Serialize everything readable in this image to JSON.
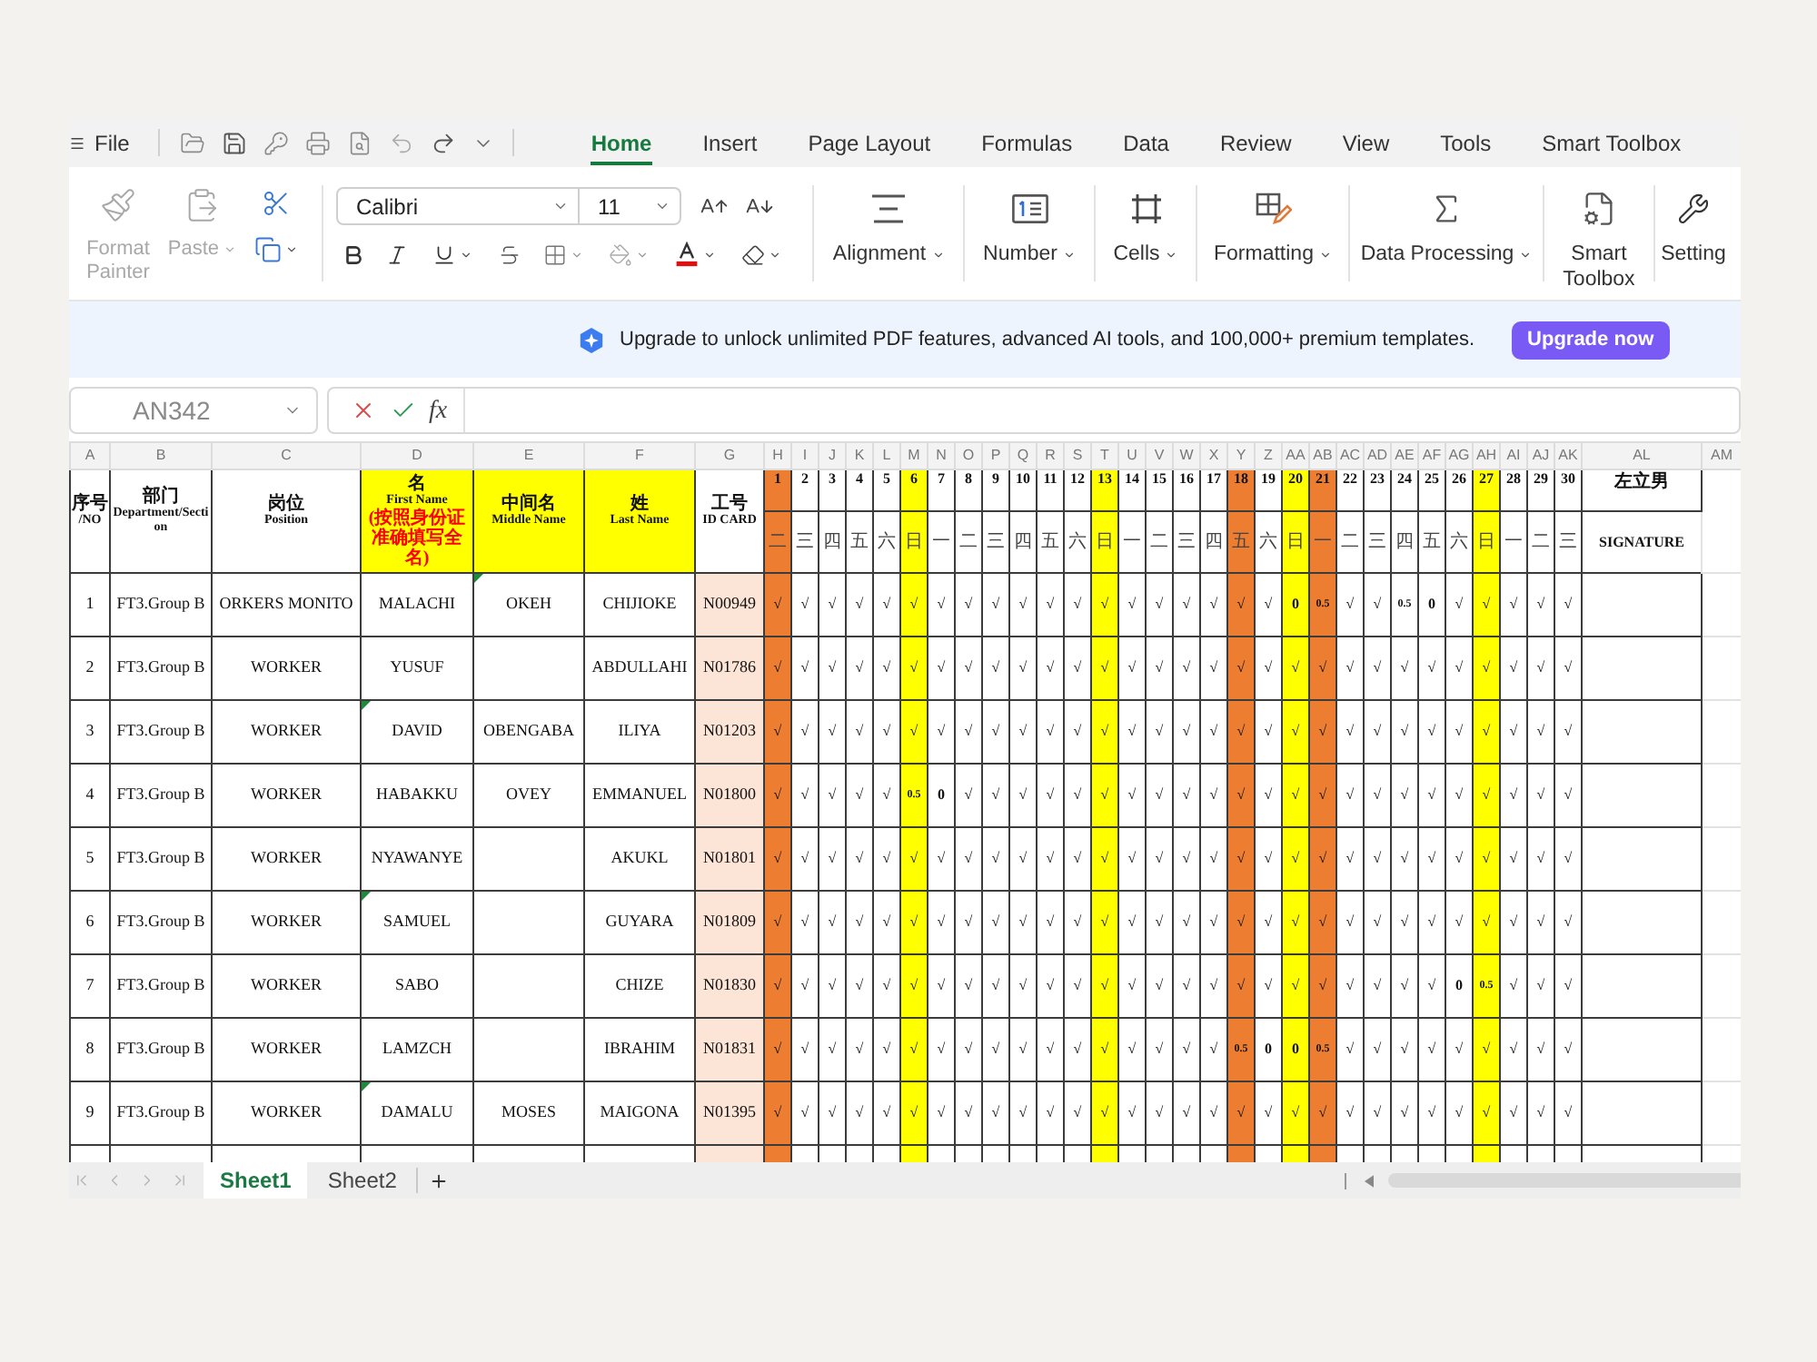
{
  "menu_bar": {
    "file": "File",
    "tabs": [
      {
        "label": "Home",
        "selected": true
      },
      {
        "label": "Insert",
        "selected": false
      },
      {
        "label": "Page Layout",
        "selected": false
      },
      {
        "label": "Formulas",
        "selected": false
      },
      {
        "label": "Data",
        "selected": false
      },
      {
        "label": "Review",
        "selected": false
      },
      {
        "label": "View",
        "selected": false
      },
      {
        "label": "Tools",
        "selected": false
      },
      {
        "label": "Smart Toolbox",
        "selected": false
      }
    ]
  },
  "ribbon": {
    "clipboard": [
      {
        "kind": "format_painter",
        "label": "Format Painter",
        "disabled": true
      },
      {
        "kind": "paste",
        "label": "Paste",
        "disabled": true
      }
    ],
    "font": {
      "family": "Calibri",
      "size": "11"
    },
    "groups": [
      {
        "kind": "alignment",
        "label": "Alignment",
        "dropdown": true
      },
      {
        "kind": "number",
        "label": "Number",
        "dropdown": true
      },
      {
        "kind": "cells",
        "label": "Cells",
        "dropdown": true
      },
      {
        "kind": "formatting",
        "label": "Formatting",
        "dropdown": true
      },
      {
        "kind": "data_processing",
        "label": "Data Processing",
        "dropdown": true
      },
      {
        "kind": "smart_toolbox",
        "label": "Smart Toolbox",
        "dropdown": false
      },
      {
        "kind": "setting",
        "label": "Setting",
        "dropdown": false
      }
    ]
  },
  "banner": {
    "message": "Upgrade to unlock unlimited PDF features, advanced AI tools, and 100,000+ premium templates.",
    "button": "Upgrade now"
  },
  "formula_bar": {
    "cell_reference": "AN342",
    "function_label": "fx"
  },
  "sheet": {
    "columns": [
      "A",
      "B",
      "C",
      "D",
      "E",
      "F",
      "G",
      "H",
      "I",
      "J",
      "K",
      "L",
      "M",
      "N",
      "O",
      "P",
      "Q",
      "R",
      "S",
      "T",
      "U",
      "V",
      "W",
      "X",
      "Y",
      "Z",
      "AA",
      "AB",
      "AC",
      "AD",
      "AE",
      "AF",
      "AG",
      "AH",
      "AI",
      "AJ",
      "AK",
      "AL",
      "AM"
    ],
    "headers": [
      {
        "kind": "no",
        "zh": "序号",
        "en": "/NO",
        "color": "#ffffff"
      },
      {
        "kind": "department",
        "zh": "部门",
        "en": "Department/Section",
        "color": "#ffffff"
      },
      {
        "kind": "position",
        "zh": "岗位",
        "en": "Position",
        "color": "#ffffff"
      },
      {
        "kind": "first_name",
        "zh": "名",
        "en": "First Name",
        "note": "(按照身份证准确填写全名)",
        "color": "#ffff00"
      },
      {
        "kind": "middle_name",
        "zh": "中间名",
        "en": "Middle Name",
        "color": "#ffff00"
      },
      {
        "kind": "last_name",
        "zh": "姓",
        "en": "Last Name",
        "color": "#ffff00"
      },
      {
        "kind": "id_card",
        "zh": "工号",
        "en": "ID CARD",
        "color": "#ffffff"
      }
    ],
    "days": [
      {
        "day": "1",
        "weekday": "二",
        "color": "#ed7d31"
      },
      {
        "day": "2",
        "weekday": "三",
        "color": "#ffffff"
      },
      {
        "day": "3",
        "weekday": "四",
        "color": "#ffffff"
      },
      {
        "day": "4",
        "weekday": "五",
        "color": "#ffffff"
      },
      {
        "day": "5",
        "weekday": "六",
        "color": "#ffffff"
      },
      {
        "day": "6",
        "weekday": "日",
        "color": "#ffff00"
      },
      {
        "day": "7",
        "weekday": "一",
        "color": "#ffffff"
      },
      {
        "day": "8",
        "weekday": "二",
        "color": "#ffffff"
      },
      {
        "day": "9",
        "weekday": "三",
        "color": "#ffffff"
      },
      {
        "day": "10",
        "weekday": "四",
        "color": "#ffffff"
      },
      {
        "day": "11",
        "weekday": "五",
        "color": "#ffffff"
      },
      {
        "day": "12",
        "weekday": "六",
        "color": "#ffffff"
      },
      {
        "day": "13",
        "weekday": "日",
        "color": "#ffff00"
      },
      {
        "day": "14",
        "weekday": "一",
        "color": "#ffffff"
      },
      {
        "day": "15",
        "weekday": "二",
        "color": "#ffffff"
      },
      {
        "day": "16",
        "weekday": "三",
        "color": "#ffffff"
      },
      {
        "day": "17",
        "weekday": "四",
        "color": "#ffffff"
      },
      {
        "day": "18",
        "weekday": "五",
        "color": "#ed7d31"
      },
      {
        "day": "19",
        "weekday": "六",
        "color": "#ffffff"
      },
      {
        "day": "20",
        "weekday": "日",
        "color": "#ffff00"
      },
      {
        "day": "21",
        "weekday": "一",
        "color": "#ed7d31"
      },
      {
        "day": "22",
        "weekday": "二",
        "color": "#ffffff"
      },
      {
        "day": "23",
        "weekday": "三",
        "color": "#ffffff"
      },
      {
        "day": "24",
        "weekday": "四",
        "color": "#ffffff"
      },
      {
        "day": "25",
        "weekday": "五",
        "color": "#ffffff"
      },
      {
        "day": "26",
        "weekday": "六",
        "color": "#ffffff"
      },
      {
        "day": "27",
        "weekday": "日",
        "color": "#ffff00"
      },
      {
        "day": "28",
        "weekday": "一",
        "color": "#ffffff"
      },
      {
        "day": "29",
        "weekday": "二",
        "color": "#ffffff"
      },
      {
        "day": "30",
        "weekday": "三",
        "color": "#ffffff"
      }
    ],
    "signature_header": {
      "top": "左立男",
      "bottom": "SIGNATURE"
    },
    "rows": [
      {
        "no": "1",
        "department": "FT3.Group B",
        "position": "ORKERS MONITO",
        "first_name": "MALACHI",
        "first_name_flag": false,
        "middle_name": "OKEH",
        "middle_name_flag": true,
        "last_name": "CHIJIOKE",
        "id_card": "N00949",
        "marks": [
          "√",
          "√",
          "√",
          "√",
          "√",
          "√",
          "√",
          "√",
          "√",
          "√",
          "√",
          "√",
          "√",
          "√",
          "√",
          "√",
          "√",
          "√",
          "√",
          "0",
          "0.5",
          "√",
          "√",
          "0.5",
          "0",
          "√",
          "√",
          "√",
          "√",
          "√"
        ]
      },
      {
        "no": "2",
        "department": "FT3.Group B",
        "position": "WORKER",
        "first_name": "YUSUF",
        "first_name_flag": false,
        "middle_name_flag": false,
        "last_name": "ABDULLAHI",
        "id_card": "N01786",
        "marks": [
          "√",
          "√",
          "√",
          "√",
          "√",
          "√",
          "√",
          "√",
          "√",
          "√",
          "√",
          "√",
          "√",
          "√",
          "√",
          "√",
          "√",
          "√",
          "√",
          "√",
          "√",
          "√",
          "√",
          "√",
          "√",
          "√",
          "√",
          "√",
          "√",
          "√"
        ]
      },
      {
        "no": "3",
        "department": "FT3.Group B",
        "position": "WORKER",
        "first_name": "DAVID",
        "first_name_flag": true,
        "middle_name": "OBENGABA",
        "middle_name_flag": false,
        "last_name": "ILIYA",
        "id_card": "N01203",
        "marks": [
          "√",
          "√",
          "√",
          "√",
          "√",
          "√",
          "√",
          "√",
          "√",
          "√",
          "√",
          "√",
          "√",
          "√",
          "√",
          "√",
          "√",
          "√",
          "√",
          "√",
          "√",
          "√",
          "√",
          "√",
          "√",
          "√",
          "√",
          "√",
          "√",
          "√"
        ]
      },
      {
        "no": "4",
        "department": "FT3.Group B",
        "position": "WORKER",
        "first_name": "HABAKKU",
        "first_name_flag": false,
        "middle_name": "OVEY",
        "middle_name_flag": false,
        "last_name": "EMMANUEL",
        "id_card": "N01800",
        "marks": [
          "√",
          "√",
          "√",
          "√",
          "√",
          "0.5",
          "0",
          "√",
          "√",
          "√",
          "√",
          "√",
          "√",
          "√",
          "√",
          "√",
          "√",
          "√",
          "√",
          "√",
          "√",
          "√",
          "√",
          "√",
          "√",
          "√",
          "√",
          "√",
          "√",
          "√"
        ]
      },
      {
        "no": "5",
        "department": "FT3.Group B",
        "position": "WORKER",
        "first_name": "NYAWANYE",
        "first_name_flag": false,
        "middle_name_flag": false,
        "last_name": "AKUKL",
        "id_card": "N01801",
        "marks": [
          "√",
          "√",
          "√",
          "√",
          "√",
          "√",
          "√",
          "√",
          "√",
          "√",
          "√",
          "√",
          "√",
          "√",
          "√",
          "√",
          "√",
          "√",
          "√",
          "√",
          "√",
          "√",
          "√",
          "√",
          "√",
          "√",
          "√",
          "√",
          "√",
          "√"
        ]
      },
      {
        "no": "6",
        "department": "FT3.Group B",
        "position": "WORKER",
        "first_name": "SAMUEL",
        "first_name_flag": true,
        "middle_name_flag": false,
        "last_name": "GUYARA",
        "id_card": "N01809",
        "marks": [
          "√",
          "√",
          "√",
          "√",
          "√",
          "√",
          "√",
          "√",
          "√",
          "√",
          "√",
          "√",
          "√",
          "√",
          "√",
          "√",
          "√",
          "√",
          "√",
          "√",
          "√",
          "√",
          "√",
          "√",
          "√",
          "√",
          "√",
          "√",
          "√",
          "√"
        ]
      },
      {
        "no": "7",
        "department": "FT3.Group B",
        "position": "WORKER",
        "first_name": "SABO",
        "first_name_flag": false,
        "middle_name_flag": false,
        "last_name": "CHIZE",
        "id_card": "N01830",
        "marks": [
          "√",
          "√",
          "√",
          "√",
          "√",
          "√",
          "√",
          "√",
          "√",
          "√",
          "√",
          "√",
          "√",
          "√",
          "√",
          "√",
          "√",
          "√",
          "√",
          "√",
          "√",
          "√",
          "√",
          "√",
          "√",
          "0",
          "0.5",
          "√",
          "√",
          "√"
        ]
      },
      {
        "no": "8",
        "department": "FT3.Group B",
        "position": "WORKER",
        "first_name": "LAMZCH",
        "first_name_flag": false,
        "middle_name_flag": false,
        "last_name": "IBRAHIM",
        "id_card": "N01831",
        "marks": [
          "√",
          "√",
          "√",
          "√",
          "√",
          "√",
          "√",
          "√",
          "√",
          "√",
          "√",
          "√",
          "√",
          "√",
          "√",
          "√",
          "√",
          "0.5",
          "0",
          "0",
          "0.5",
          "√",
          "√",
          "√",
          "√",
          "√",
          "√",
          "√",
          "√",
          "√"
        ]
      },
      {
        "no": "9",
        "department": "FT3.Group B",
        "position": "WORKER",
        "first_name": "DAMALU",
        "first_name_flag": true,
        "middle_name": "MOSES",
        "middle_name_flag": false,
        "last_name": "MAIGONA",
        "id_card": "N01395",
        "marks": [
          "√",
          "√",
          "√",
          "√",
          "√",
          "√",
          "√",
          "√",
          "√",
          "√",
          "√",
          "√",
          "√",
          "√",
          "√",
          "√",
          "√",
          "√",
          "√",
          "√",
          "√",
          "√",
          "√",
          "√",
          "√",
          "√",
          "√",
          "√",
          "√",
          "√"
        ]
      }
    ]
  },
  "sheet_tabs": [
    {
      "label": "Sheet1",
      "selected": true
    },
    {
      "label": "Sheet2",
      "selected": false
    }
  ]
}
